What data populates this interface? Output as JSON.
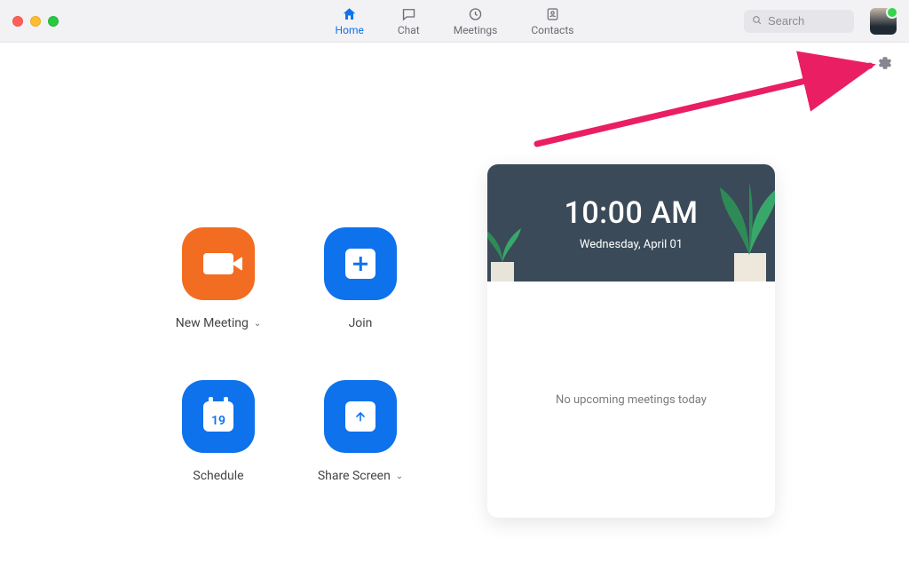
{
  "nav": {
    "home": {
      "label": "Home"
    },
    "chat": {
      "label": "Chat"
    },
    "meetings": {
      "label": "Meetings"
    },
    "contacts": {
      "label": "Contacts"
    },
    "active": "home"
  },
  "search": {
    "placeholder": "Search"
  },
  "actions": {
    "new_meeting": {
      "label": "New Meeting",
      "has_dropdown": true
    },
    "join": {
      "label": "Join",
      "has_dropdown": false
    },
    "schedule": {
      "label": "Schedule",
      "has_dropdown": false,
      "calendar_day": "19"
    },
    "share_screen": {
      "label": "Share Screen",
      "has_dropdown": true
    }
  },
  "clock_card": {
    "time": "10:00 AM",
    "date": "Wednesday, April 01",
    "empty_state": "No upcoming meetings today"
  },
  "colors": {
    "accent_blue": "#0e72ed",
    "accent_orange": "#f26d21",
    "header_grey": "#3a4a59",
    "annotation_pink": "#e91e63"
  }
}
